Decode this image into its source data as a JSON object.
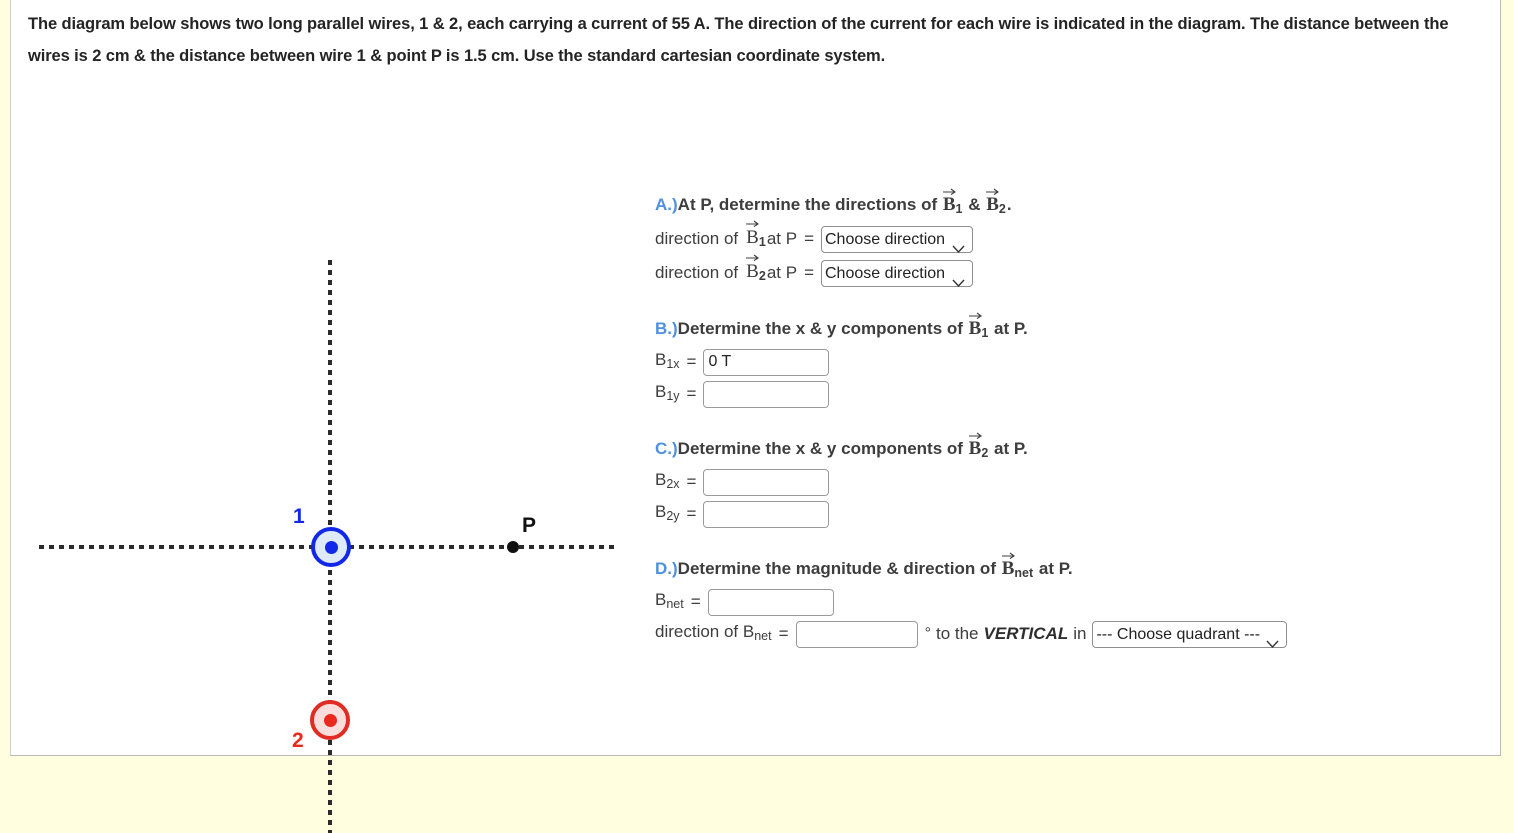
{
  "problem": {
    "statement": "The diagram below shows two long parallel wires, 1 & 2, each carrying a current of 55 A. The direction of the current for each wire is indicated in the diagram. The distance between the wires is 2 cm & the distance between wire 1 & point P is 1.5 cm. Use the standard cartesian coordinate system."
  },
  "diagram": {
    "wire1_label": "1",
    "wire2_label": "2",
    "point_label": "P",
    "wire1_color": "#1128e8",
    "wire2_color": "#e8291b",
    "wire1_direction": "out-of-page",
    "wire2_direction": "out-of-page"
  },
  "sections": {
    "a": {
      "letter": "A.)",
      "heading_pre": "At P, determine the directions of ",
      "heading_amp": " & ",
      "heading_post": ".",
      "b1_sub": "1",
      "b2_sub": "2",
      "row1_pre": "direction of ",
      "row1_mid": " at P",
      "row1_eq": "=",
      "row1_select_value": "Choose direction",
      "row2_pre": "direction of ",
      "row2_mid": " at P",
      "row2_eq": "=",
      "row2_select_value": "Choose direction"
    },
    "b": {
      "letter": "B.)",
      "heading_pre": "Determine the x & y components of ",
      "heading_post": " at P.",
      "b_sub": "1",
      "row1_label": "B",
      "row1_sub": "1x",
      "row1_eq": "=",
      "row1_value": "0 T",
      "row2_label": "B",
      "row2_sub": "1y",
      "row2_eq": "=",
      "row2_value": ""
    },
    "c": {
      "letter": "C.)",
      "heading_pre": "Determine the x & y components of ",
      "heading_post": " at P.",
      "b_sub": "2",
      "row1_label": "B",
      "row1_sub": "2x",
      "row1_eq": "=",
      "row1_value": "",
      "row2_label": "B",
      "row2_sub": "2y",
      "row2_eq": "=",
      "row2_value": ""
    },
    "d": {
      "letter": "D.)",
      "heading_pre": "Determine the magnitude & direction of ",
      "heading_post": " at P.",
      "b_sub": "net",
      "row1_label": "B",
      "row1_sub": "net",
      "row1_eq": "=",
      "row1_value": "",
      "row2_pre": "direction of B",
      "row2_sub": "net",
      "row2_eq": "=",
      "row2_value": "",
      "degree": "°",
      "to_the": "to the",
      "vertical": "VERTICAL",
      "in_word": "in",
      "quadrant_value": "--- Choose quadrant ---"
    }
  },
  "colors": {
    "accent": "#4f90e0",
    "page_bg": "#FFFFE0",
    "panel_bg": "#ffffff",
    "text": "#333333"
  }
}
